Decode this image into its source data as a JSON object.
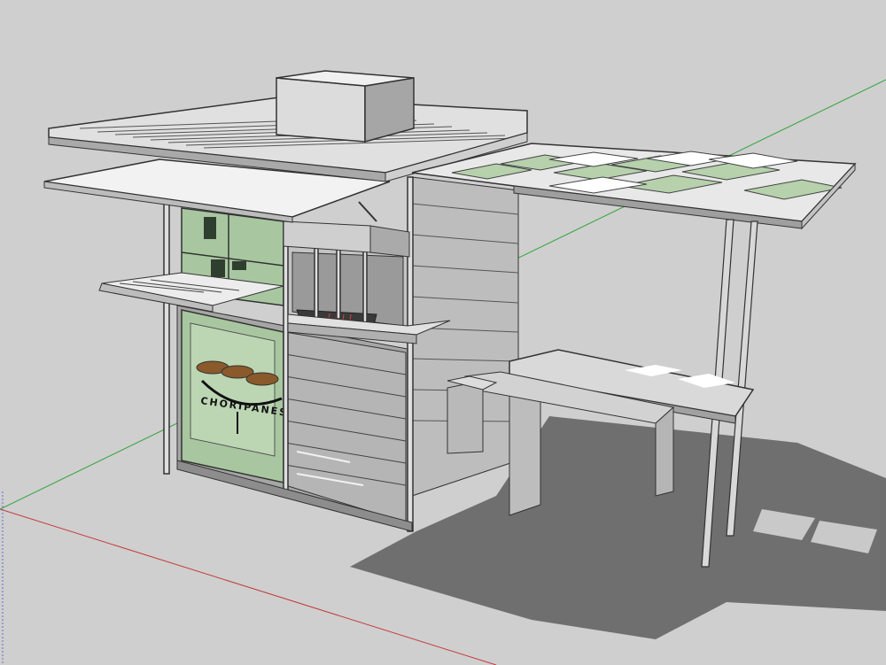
{
  "scene": {
    "sign_text": "CHORIPANES",
    "colors": {
      "background": "#cfcfcf",
      "shadow": "#6f6f6f",
      "metal": "#e6e6e6",
      "metal_dark": "#a9a9a9",
      "glass": "#a8c7a0",
      "glass_dark": "#6f8f6b",
      "axis_red": "#c53a3a",
      "axis_green": "#2fa43a",
      "axis_blue": "#5b6fd0"
    }
  }
}
